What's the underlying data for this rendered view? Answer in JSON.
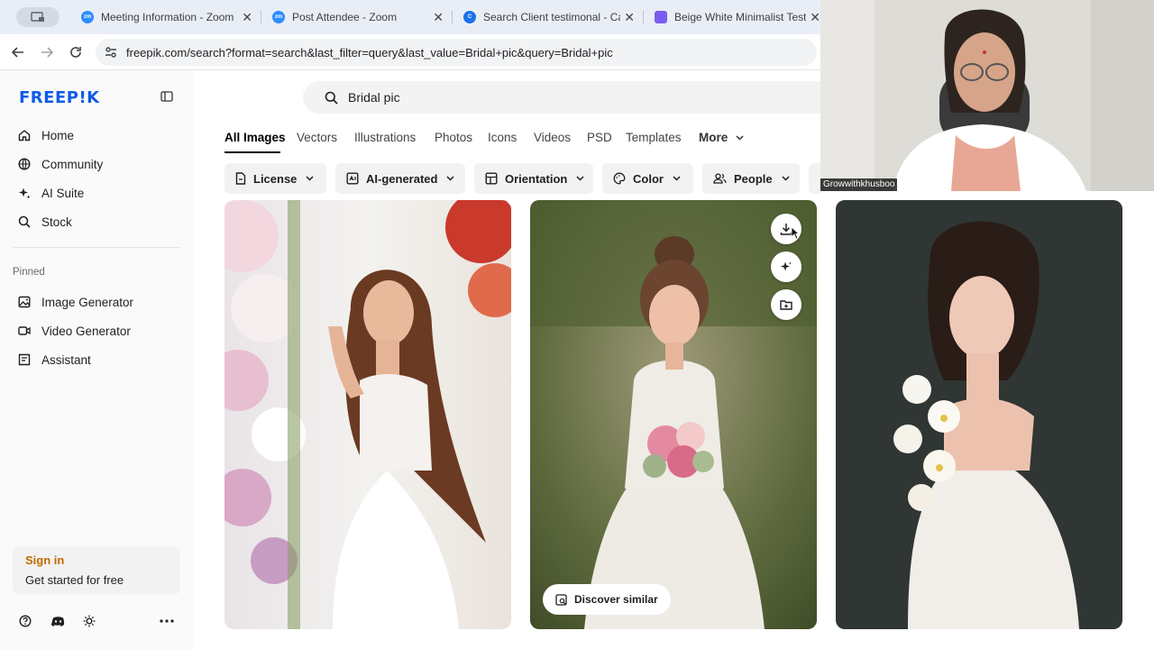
{
  "browser": {
    "tabs": [
      {
        "title": "Meeting Information - Zoom",
        "fav_text": "zm",
        "fav_color": "#2d8cff"
      },
      {
        "title": "Post Attendee - Zoom",
        "fav_text": "zm",
        "fav_color": "#2d8cff"
      },
      {
        "title": "Search Client testimonal - Ca",
        "fav_text": "C",
        "fav_color": "#1a73e8"
      },
      {
        "title": "Beige White Minimalist Testin",
        "fav_text": "",
        "fav_color": "#7b5cf0"
      }
    ],
    "url": "freepik.com/search?format=search&last_filter=query&last_value=Bridal+pic&query=Bridal+pic"
  },
  "sidebar": {
    "logo": "FREEP!K",
    "nav": [
      {
        "label": "Home",
        "icon": "home-icon"
      },
      {
        "label": "Community",
        "icon": "globe-icon"
      },
      {
        "label": "AI Suite",
        "icon": "sparkle-icon"
      },
      {
        "label": "Stock",
        "icon": "search-icon"
      }
    ],
    "pinned_heading": "Pinned",
    "pinned": [
      {
        "label": "Image Generator",
        "icon": "image-icon"
      },
      {
        "label": "Video Generator",
        "icon": "video-icon"
      },
      {
        "label": "Assistant",
        "icon": "assistant-icon"
      }
    ],
    "signin": {
      "title": "Sign in",
      "subtitle": "Get started for free"
    }
  },
  "search": {
    "query": "Bridal pic"
  },
  "categories": [
    "All Images",
    "Vectors",
    "Illustrations",
    "Photos",
    "Icons",
    "Videos",
    "PSD",
    "Templates",
    "More"
  ],
  "filters": [
    "License",
    "AI-generated",
    "Orientation",
    "Color",
    "People"
  ],
  "results": {
    "discover_label": "Discover similar"
  },
  "video": {
    "participant": "Growwithkhusboo"
  },
  "colors": {
    "brand": "#0e5ce6",
    "signin": "#c26a00"
  }
}
